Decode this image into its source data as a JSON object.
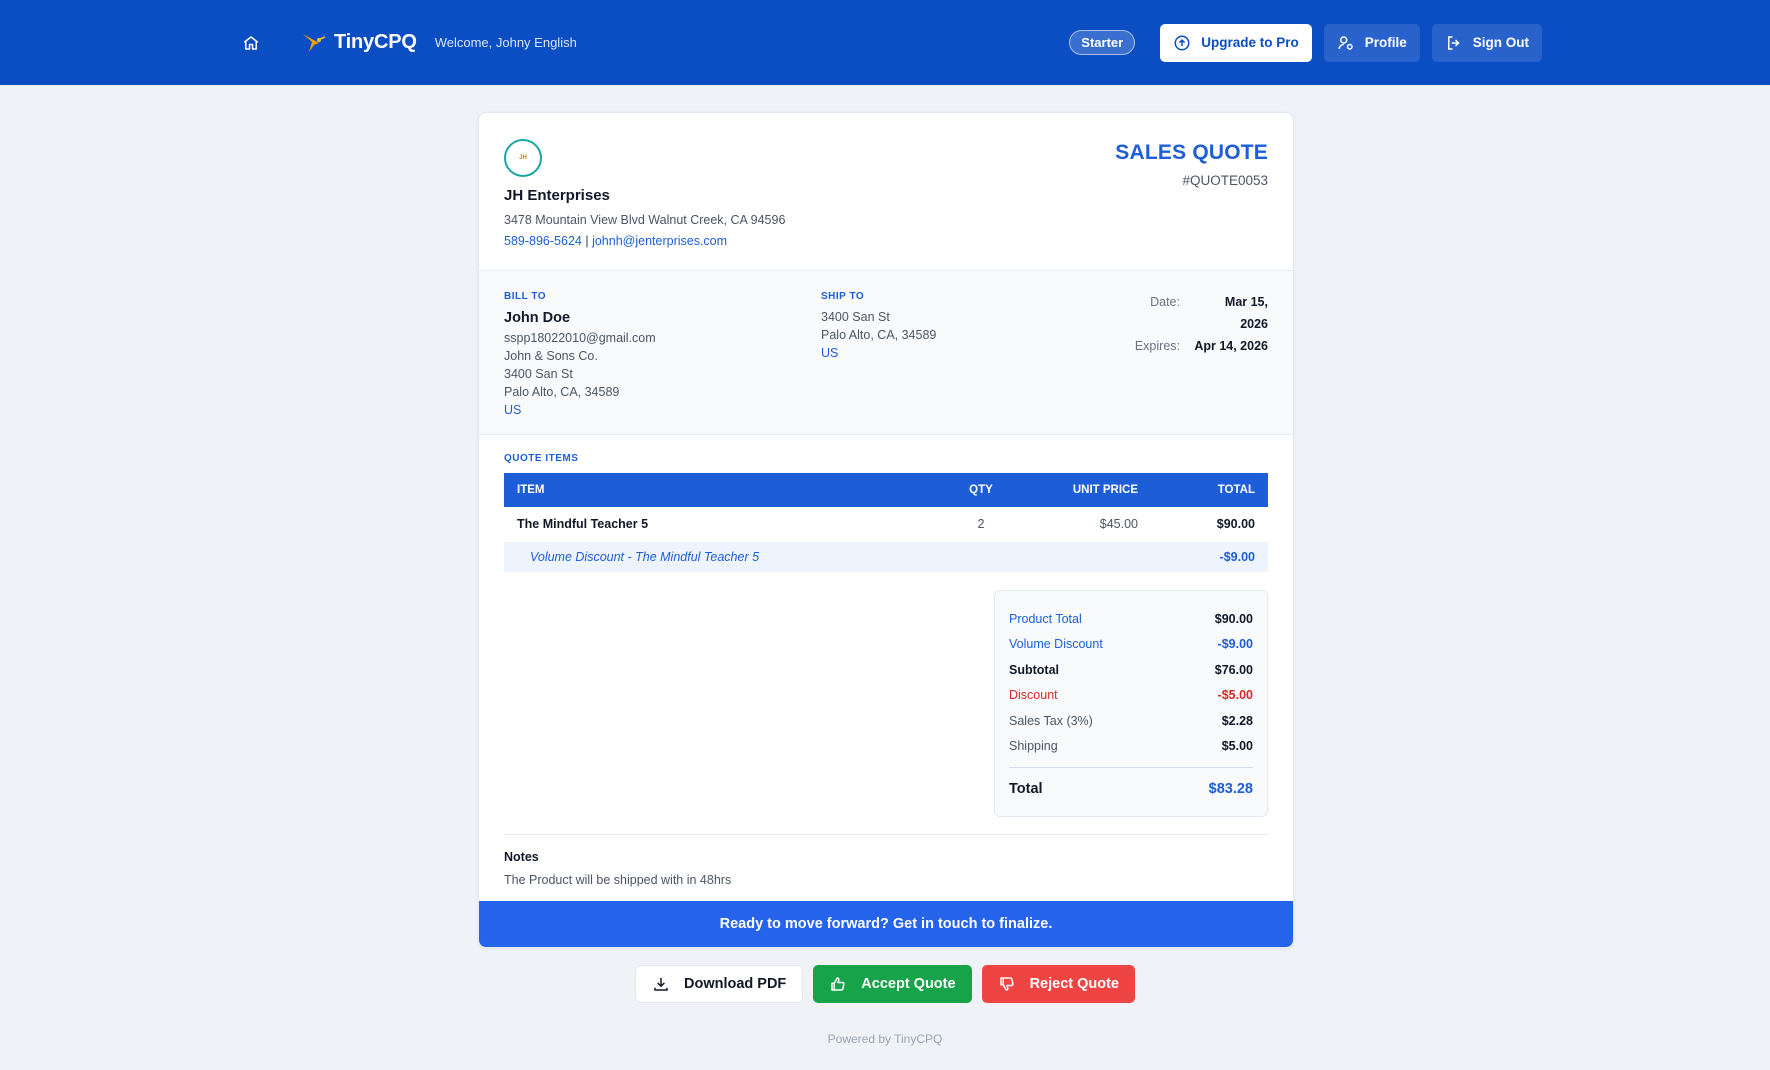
{
  "header": {
    "home_icon": "home-icon",
    "brand_icon": "hummingbird-logo-icon",
    "brand_name": "TinyCPQ",
    "welcome": "Welcome, Johny English",
    "plan_badge": "Starter",
    "upgrade_label": "Upgrade to Pro",
    "profile_label": "Profile",
    "signout_label": "Sign Out",
    "colors": {
      "bar": "#0b4dc2"
    }
  },
  "company": {
    "logo_text": "JH Enterprises",
    "name": "JH Enterprises",
    "address": "3478 Mountain View Blvd Walnut Creek, CA 94596",
    "phone": "589-896-5624",
    "separator": "|",
    "email": "johnh@jenterprises.com"
  },
  "quote": {
    "title": "SALES QUOTE",
    "number": "#QUOTE0053"
  },
  "bill_to": {
    "label": "BILL TO",
    "name": "John Doe",
    "email": "sspp18022010@gmail.com",
    "company": "John & Sons Co.",
    "street": "3400 San St",
    "city": "Palo Alto, CA, 34589",
    "country": "US"
  },
  "ship_to": {
    "label": "SHIP TO",
    "street": "3400 San St",
    "city": "Palo Alto, CA, 34589",
    "country": "US"
  },
  "dates": {
    "date_label": "Date:",
    "date_value": "Mar 15, 2026",
    "expires_label": "Expires:",
    "expires_value": "Apr 14, 2026"
  },
  "items": {
    "section_label": "QUOTE ITEMS",
    "columns": {
      "item": "ITEM",
      "qty": "QTY",
      "unit": "UNIT PRICE",
      "total": "TOTAL"
    },
    "rows": [
      {
        "item": "The Mindful Teacher 5",
        "qty": "2",
        "unit": "$45.00",
        "total": "$90.00"
      }
    ],
    "discount_row": {
      "item": "Volume Discount - The Mindful Teacher 5",
      "total": "-$9.00"
    }
  },
  "totals": {
    "product_total": {
      "label": "Product Total",
      "value": "$90.00"
    },
    "volume_discount": {
      "label": "Volume Discount",
      "value": "-$9.00"
    },
    "subtotal": {
      "label": "Subtotal",
      "value": "$76.00"
    },
    "discount": {
      "label": "Discount",
      "value": "-$5.00"
    },
    "sales_tax": {
      "label": "Sales Tax (3%)",
      "value": "$2.28"
    },
    "shipping": {
      "label": "Shipping",
      "value": "$5.00"
    },
    "total": {
      "label": "Total",
      "value": "$83.28"
    }
  },
  "notes": {
    "title": "Notes",
    "body": "The Product will be shipped with in 48hrs"
  },
  "cta": "Ready to move forward? Get in touch to finalize.",
  "actions": {
    "download_label": "Download PDF",
    "accept_label": "Accept Quote",
    "reject_label": "Reject Quote"
  },
  "footer": "Powered by TinyCPQ"
}
